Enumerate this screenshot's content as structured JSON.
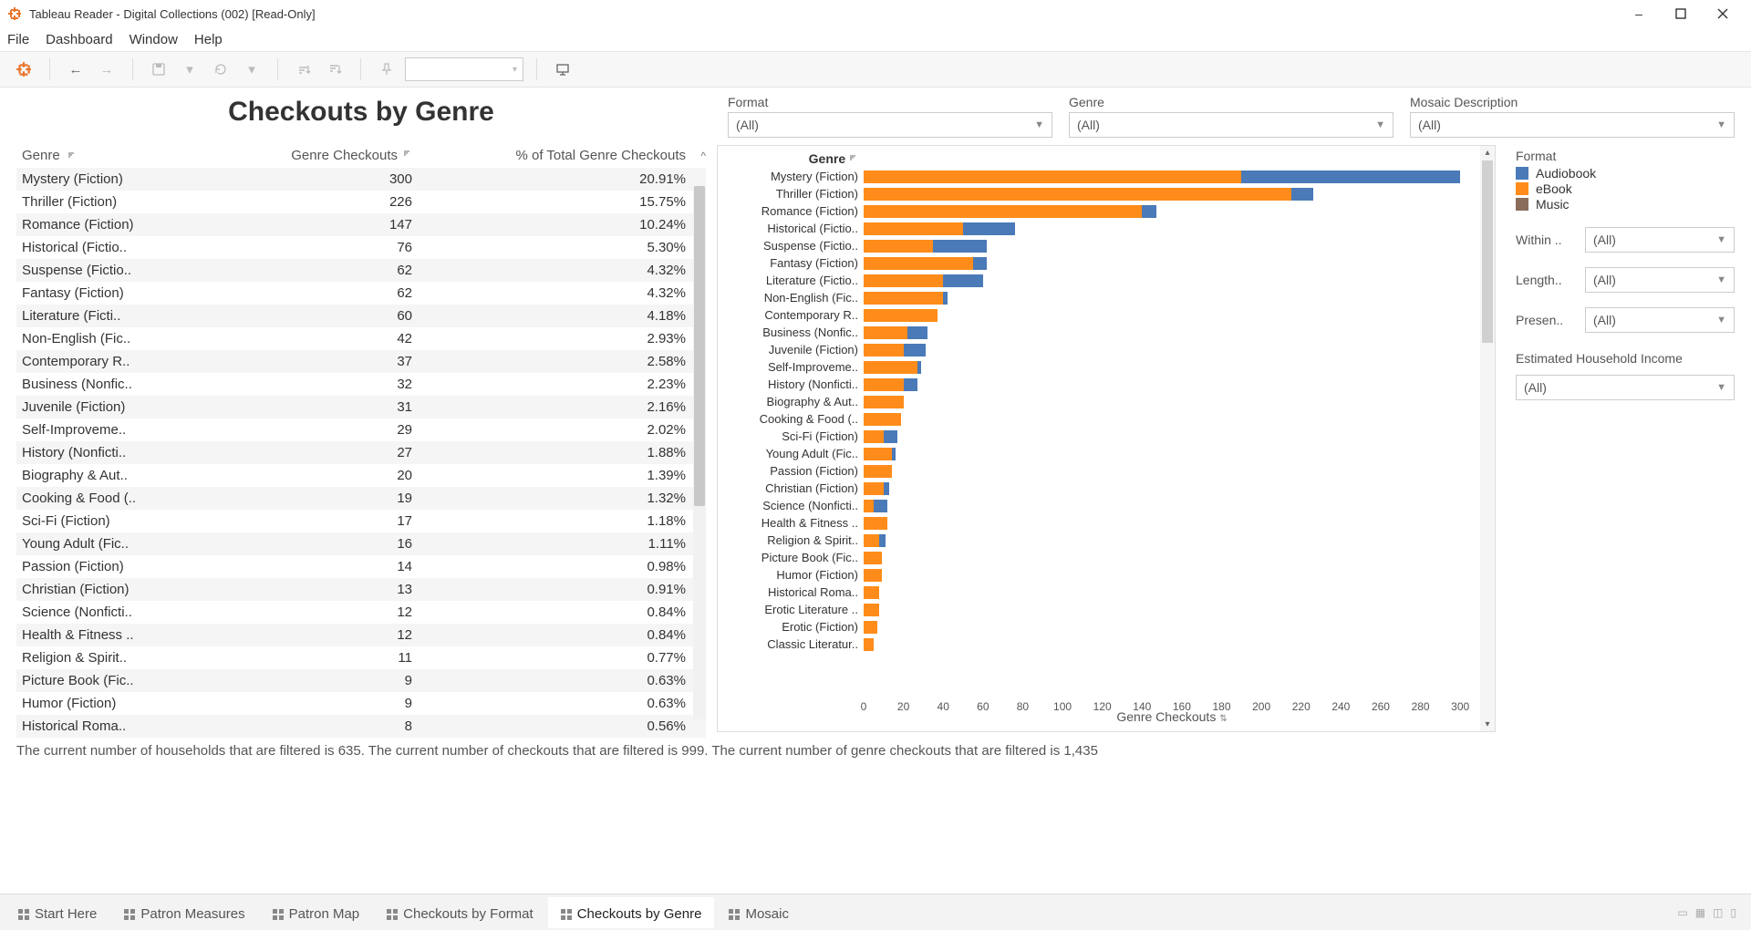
{
  "window": {
    "title": "Tableau Reader - Digital Collections (002) [Read-Only]"
  },
  "menubar": [
    "File",
    "Dashboard",
    "Window",
    "Help"
  ],
  "table": {
    "title": "Checkouts by Genre",
    "headers": {
      "genre": "Genre",
      "checkouts": "Genre Checkouts",
      "pct": "% of Total Genre Checkouts"
    },
    "rows": [
      {
        "genre": "Mystery (Fiction)",
        "checkouts": 300,
        "pct": "20.91%"
      },
      {
        "genre": "Thriller (Fiction)",
        "checkouts": 226,
        "pct": "15.75%"
      },
      {
        "genre": "Romance (Fiction)",
        "checkouts": 147,
        "pct": "10.24%"
      },
      {
        "genre": "Historical (Fictio..",
        "checkouts": 76,
        "pct": "5.30%"
      },
      {
        "genre": "Suspense (Fictio..",
        "checkouts": 62,
        "pct": "4.32%"
      },
      {
        "genre": "Fantasy (Fiction)",
        "checkouts": 62,
        "pct": "4.32%"
      },
      {
        "genre": "Literature (Ficti..",
        "checkouts": 60,
        "pct": "4.18%"
      },
      {
        "genre": "Non-English (Fic..",
        "checkouts": 42,
        "pct": "2.93%"
      },
      {
        "genre": "Contemporary R..",
        "checkouts": 37,
        "pct": "2.58%"
      },
      {
        "genre": "Business (Nonfic..",
        "checkouts": 32,
        "pct": "2.23%"
      },
      {
        "genre": "Juvenile (Fiction)",
        "checkouts": 31,
        "pct": "2.16%"
      },
      {
        "genre": "Self-Improveme..",
        "checkouts": 29,
        "pct": "2.02%"
      },
      {
        "genre": "History (Nonficti..",
        "checkouts": 27,
        "pct": "1.88%"
      },
      {
        "genre": "Biography & Aut..",
        "checkouts": 20,
        "pct": "1.39%"
      },
      {
        "genre": "Cooking & Food (..",
        "checkouts": 19,
        "pct": "1.32%"
      },
      {
        "genre": "Sci-Fi (Fiction)",
        "checkouts": 17,
        "pct": "1.18%"
      },
      {
        "genre": "Young Adult (Fic..",
        "checkouts": 16,
        "pct": "1.11%"
      },
      {
        "genre": "Passion (Fiction)",
        "checkouts": 14,
        "pct": "0.98%"
      },
      {
        "genre": "Christian (Fiction)",
        "checkouts": 13,
        "pct": "0.91%"
      },
      {
        "genre": "Science (Nonficti..",
        "checkouts": 12,
        "pct": "0.84%"
      },
      {
        "genre": "Health & Fitness ..",
        "checkouts": 12,
        "pct": "0.84%"
      },
      {
        "genre": "Religion & Spirit..",
        "checkouts": 11,
        "pct": "0.77%"
      },
      {
        "genre": "Picture Book (Fic..",
        "checkouts": 9,
        "pct": "0.63%"
      },
      {
        "genre": "Humor (Fiction)",
        "checkouts": 9,
        "pct": "0.63%"
      },
      {
        "genre": "Historical Roma..",
        "checkouts": 8,
        "pct": "0.56%"
      }
    ]
  },
  "top_filters": {
    "format": {
      "label": "Format",
      "value": "(All)"
    },
    "genre": {
      "label": "Genre",
      "value": "(All)"
    },
    "mosaic": {
      "label": "Mosaic Description",
      "value": "(All)"
    }
  },
  "legend": {
    "title": "Format",
    "items": [
      {
        "name": "Audiobook",
        "color": "#4a7ab8"
      },
      {
        "name": "eBook",
        "color": "#ff8c1a"
      },
      {
        "name": "Music",
        "color": "#8b6d5c"
      }
    ]
  },
  "side_filters": {
    "within": {
      "label": "Within ..",
      "value": "(All)"
    },
    "length": {
      "label": "Length..",
      "value": "(All)"
    },
    "presen": {
      "label": "Presen..",
      "value": "(All)"
    },
    "income_label": "Estimated Household Income",
    "income_value": "(All)"
  },
  "chart_header": "Genre",
  "chart_axis_title": "Genre Checkouts",
  "chart_ticks": [
    0,
    20,
    40,
    60,
    80,
    100,
    120,
    140,
    160,
    180,
    200,
    220,
    240,
    260,
    280,
    300
  ],
  "chart_data": {
    "type": "bar",
    "orientation": "horizontal",
    "stacked": true,
    "title": "Checkouts by Genre",
    "xlabel": "Genre Checkouts",
    "ylabel": "Genre",
    "xlim": [
      0,
      310
    ],
    "categories": [
      "Mystery (Fiction)",
      "Thriller (Fiction)",
      "Romance (Fiction)",
      "Historical (Fictio..",
      "Suspense (Fictio..",
      "Fantasy (Fiction)",
      "Literature (Fictio..",
      "Non-English (Fic..",
      "Contemporary R..",
      "Business (Nonfic..",
      "Juvenile (Fiction)",
      "Self-Improveme..",
      "History (Nonficti..",
      "Biography & Aut..",
      "Cooking & Food (..",
      "Sci-Fi (Fiction)",
      "Young Adult (Fic..",
      "Passion (Fiction)",
      "Christian (Fiction)",
      "Science (Nonficti..",
      "Health & Fitness ..",
      "Religion & Spirit..",
      "Picture Book (Fic..",
      "Humor (Fiction)",
      "Historical Roma..",
      "Erotic Literature ..",
      "Erotic (Fiction)",
      "Classic Literatur.."
    ],
    "series": [
      {
        "name": "eBook",
        "color": "#ff8c1a",
        "values": [
          190,
          215,
          140,
          50,
          35,
          55,
          40,
          40,
          37,
          22,
          20,
          27,
          20,
          20,
          19,
          10,
          14,
          14,
          10,
          5,
          12,
          8,
          9,
          9,
          8,
          8,
          7,
          5
        ]
      },
      {
        "name": "Audiobook",
        "color": "#4a7ab8",
        "values": [
          110,
          11,
          7,
          26,
          27,
          7,
          20,
          2,
          0,
          10,
          11,
          2,
          7,
          0,
          0,
          7,
          2,
          0,
          3,
          7,
          0,
          3,
          0,
          0,
          0,
          0,
          0,
          0
        ]
      }
    ],
    "legend": [
      "Audiobook",
      "eBook",
      "Music"
    ]
  },
  "status": "The current number of households that are filtered is 635. The current number of checkouts that are filtered is 999. The current number of genre checkouts that are filtered is 1,435",
  "tabs": [
    {
      "label": "Start Here",
      "active": false
    },
    {
      "label": "Patron Measures",
      "active": false
    },
    {
      "label": "Patron Map",
      "active": false
    },
    {
      "label": "Checkouts by Format",
      "active": false
    },
    {
      "label": "Checkouts by Genre",
      "active": true
    },
    {
      "label": "Mosaic",
      "active": false
    }
  ]
}
